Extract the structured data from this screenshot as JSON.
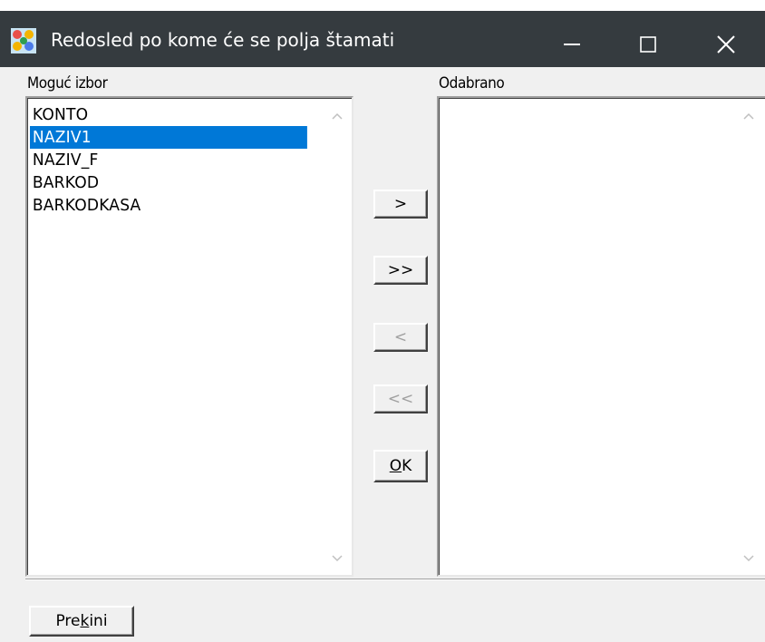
{
  "window": {
    "title": "Redosled po kome će se polja štamati",
    "controls": {
      "minimize_icon": "minimize-icon",
      "maximize_icon": "maximize-icon",
      "close_icon": "close-icon"
    }
  },
  "available": {
    "label": "Moguć izbor",
    "items": [
      "KONTO",
      "NAZIV1",
      "NAZIV_F",
      "BARKOD",
      "BARKODKASA"
    ],
    "selected_index": 1
  },
  "chosen": {
    "label": "Odabrano",
    "items": []
  },
  "buttons": {
    "add": ">",
    "add_all": ">>",
    "remove": "<",
    "remove_all": "<<",
    "ok_prefix": "O",
    "ok_rest": "K",
    "cancel_prefix": "Pre",
    "cancel_accel": "k",
    "cancel_rest": "ini"
  },
  "colors": {
    "titlebar": "#353b3f",
    "selection": "#0078d7",
    "background": "#f0f0f0"
  }
}
